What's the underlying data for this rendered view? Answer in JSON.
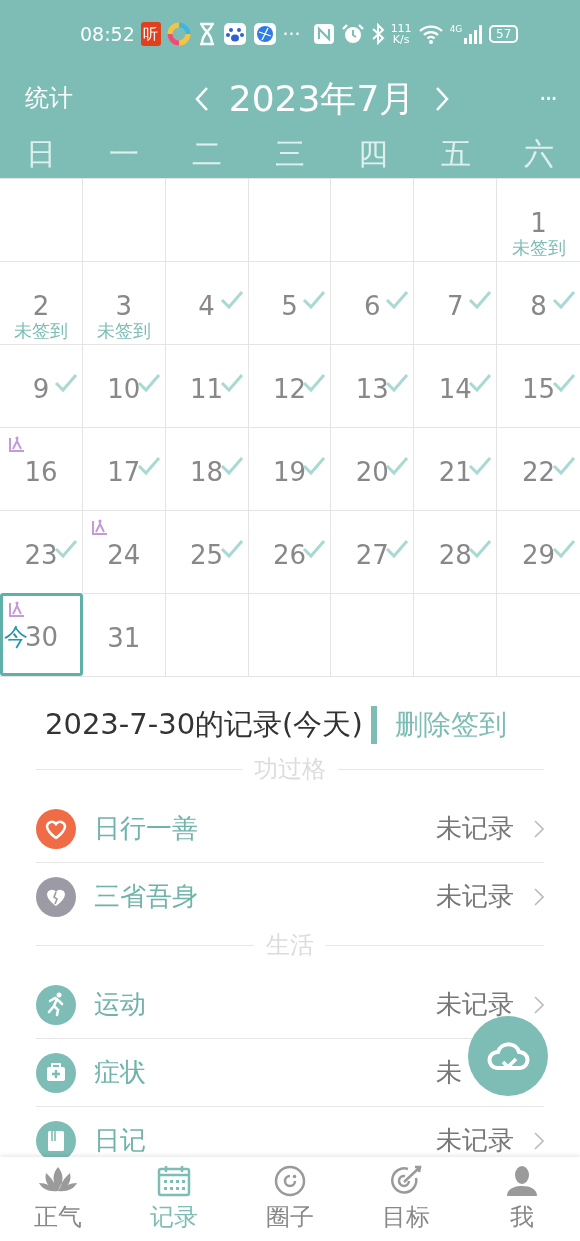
{
  "status_bar": {
    "time": "08:52",
    "notifications": [
      {
        "kind": "text-app",
        "text": "听"
      },
      {
        "kind": "ring"
      },
      {
        "kind": "hourglass"
      },
      {
        "kind": "paw"
      },
      {
        "kind": "globe"
      },
      {
        "kind": "more",
        "text": "···"
      }
    ],
    "system": [
      {
        "kind": "nfc"
      },
      {
        "kind": "alarm"
      },
      {
        "kind": "bluetooth"
      },
      {
        "kind": "speed",
        "text": "111",
        "unit": "K/s"
      },
      {
        "kind": "wifi"
      },
      {
        "kind": "signal",
        "text": "4G"
      },
      {
        "kind": "battery",
        "text": "57"
      }
    ]
  },
  "header": {
    "left": "统计",
    "title": "2023年7月",
    "more": "···"
  },
  "weekdays": [
    "日",
    "一",
    "二",
    "三",
    "四",
    "五",
    "六"
  ],
  "weeks": [
    [
      {
        "kind": "blank"
      },
      {
        "kind": "blank"
      },
      {
        "kind": "blank"
      },
      {
        "kind": "blank"
      },
      {
        "kind": "blank"
      },
      {
        "kind": "blank"
      },
      {
        "kind": "day",
        "day": "1",
        "note": "未签到",
        "signed": false,
        "marked": false,
        "today": false
      }
    ],
    [
      {
        "kind": "day",
        "day": "2",
        "note": "未签到",
        "signed": false,
        "marked": false,
        "today": false
      },
      {
        "kind": "day",
        "day": "3",
        "note": "未签到",
        "signed": false,
        "marked": false,
        "today": false
      },
      {
        "kind": "day",
        "day": "4",
        "signed": true,
        "marked": false,
        "today": false
      },
      {
        "kind": "day",
        "day": "5",
        "signed": true,
        "marked": false,
        "today": false
      },
      {
        "kind": "day",
        "day": "6",
        "signed": true,
        "marked": false,
        "today": false
      },
      {
        "kind": "day",
        "day": "7",
        "signed": true,
        "marked": false,
        "today": false
      },
      {
        "kind": "day",
        "day": "8",
        "signed": true,
        "marked": false,
        "today": false
      }
    ],
    [
      {
        "kind": "day",
        "day": "9",
        "signed": true,
        "marked": false,
        "today": false
      },
      {
        "kind": "day",
        "day": "10",
        "signed": true,
        "marked": false,
        "today": false
      },
      {
        "kind": "day",
        "day": "11",
        "signed": true,
        "marked": false,
        "today": false
      },
      {
        "kind": "day",
        "day": "12",
        "signed": true,
        "marked": false,
        "today": false
      },
      {
        "kind": "day",
        "day": "13",
        "signed": true,
        "marked": false,
        "today": false
      },
      {
        "kind": "day",
        "day": "14",
        "signed": true,
        "marked": false,
        "today": false
      },
      {
        "kind": "day",
        "day": "15",
        "signed": true,
        "marked": false,
        "today": false
      }
    ],
    [
      {
        "kind": "day",
        "day": "16",
        "signed": false,
        "marked": true,
        "today": false
      },
      {
        "kind": "day",
        "day": "17",
        "signed": true,
        "marked": false,
        "today": false
      },
      {
        "kind": "day",
        "day": "18",
        "signed": true,
        "marked": false,
        "today": false
      },
      {
        "kind": "day",
        "day": "19",
        "signed": true,
        "marked": false,
        "today": false
      },
      {
        "kind": "day",
        "day": "20",
        "signed": true,
        "marked": false,
        "today": false
      },
      {
        "kind": "day",
        "day": "21",
        "signed": true,
        "marked": false,
        "today": false
      },
      {
        "kind": "day",
        "day": "22",
        "signed": true,
        "marked": false,
        "today": false
      }
    ],
    [
      {
        "kind": "day",
        "day": "23",
        "signed": true,
        "marked": false,
        "today": false
      },
      {
        "kind": "day",
        "day": "24",
        "signed": false,
        "marked": true,
        "today": false
      },
      {
        "kind": "day",
        "day": "25",
        "signed": true,
        "marked": false,
        "today": false
      },
      {
        "kind": "day",
        "day": "26",
        "signed": true,
        "marked": false,
        "today": false
      },
      {
        "kind": "day",
        "day": "27",
        "signed": true,
        "marked": false,
        "today": false
      },
      {
        "kind": "day",
        "day": "28",
        "signed": true,
        "marked": false,
        "today": false
      },
      {
        "kind": "day",
        "day": "29",
        "signed": true,
        "marked": false,
        "today": false
      }
    ],
    [
      {
        "kind": "day",
        "day": "30",
        "today_label": "今",
        "signed": false,
        "marked": true,
        "today": true
      },
      {
        "kind": "day",
        "day": "31",
        "signed": false,
        "marked": false,
        "today": false
      },
      {
        "kind": "blank"
      },
      {
        "kind": "blank"
      },
      {
        "kind": "blank"
      },
      {
        "kind": "blank"
      },
      {
        "kind": "blank"
      }
    ]
  ],
  "record": {
    "title": "2023-7-30的记录(今天)",
    "action": "删除签到",
    "sections": [
      {
        "title": "功过格",
        "items": [
          {
            "label": "日行一善",
            "status": "未记录",
            "kind": "heart",
            "color": "#ef6c46",
            "arrow": true
          },
          {
            "label": "三省吾身",
            "status": "未记录",
            "kind": "broken-heart",
            "color": "#9c9ba5",
            "arrow": true
          }
        ]
      },
      {
        "title": "生活",
        "items": [
          {
            "label": "运动",
            "status": "未记录",
            "kind": "runner",
            "color": "#7dbdb5",
            "arrow": true
          },
          {
            "label": "症状",
            "status": "未",
            "kind": "medkit",
            "color": "#7dbdb5",
            "arrow": false
          },
          {
            "label": "日记",
            "status": "未记录",
            "kind": "book",
            "color": "#7dbdb5",
            "arrow": true
          }
        ]
      }
    ]
  },
  "nav": [
    {
      "label": "正气",
      "kind": "lotus",
      "selected": false
    },
    {
      "label": "记录",
      "kind": "calendar",
      "selected": true
    },
    {
      "label": "圈子",
      "kind": "ring",
      "selected": false
    },
    {
      "label": "目标",
      "kind": "target",
      "selected": false
    },
    {
      "label": "我",
      "kind": "person",
      "selected": false
    }
  ]
}
